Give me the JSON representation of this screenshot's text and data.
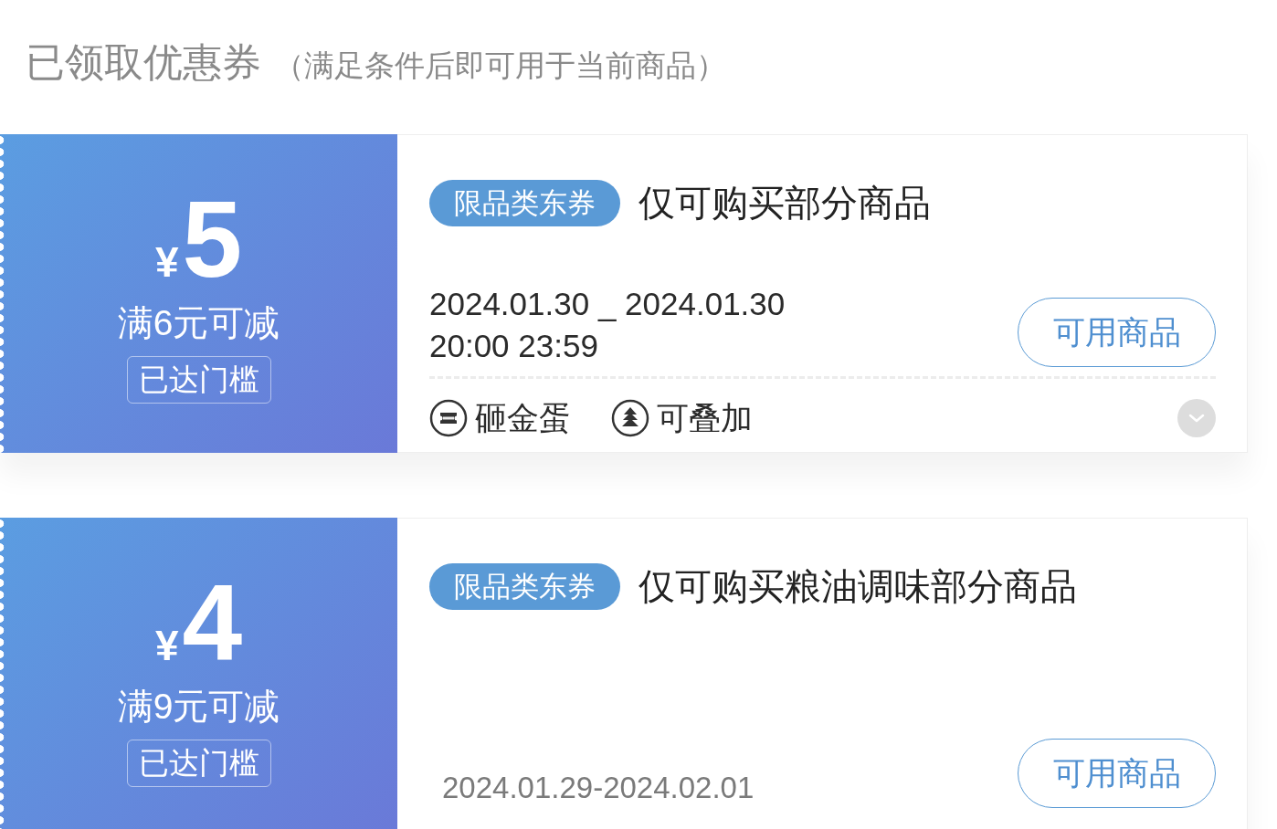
{
  "header": {
    "title": "已领取优惠券",
    "note": "（满足条件后即可用于当前商品）"
  },
  "coupons": [
    {
      "currency": "¥",
      "amount": "5",
      "condition": "满6元可减",
      "threshold_badge": "已达门槛",
      "tag": "限品类东券",
      "title": "仅可购买部分商品",
      "validity": {
        "kind": "detailed",
        "lines": [
          "2024.01.30 _ 2024.01.30",
          "20:00 23:59"
        ]
      },
      "button": "可用商品",
      "perks": [
        {
          "kind": "egg",
          "label": "砸金蛋"
        },
        {
          "kind": "stack",
          "label": "可叠加"
        }
      ],
      "toggle": {
        "expanded": false
      }
    },
    {
      "currency": "¥",
      "amount": "4",
      "condition": "满9元可减",
      "threshold_badge": "已达门槛",
      "tag": "限品类东券",
      "title": "仅可购买粮油调味部分商品",
      "validity": {
        "kind": "compact",
        "lines": [
          "2024.01.29-2024.02.01"
        ]
      },
      "button": "可用商品"
    }
  ]
}
